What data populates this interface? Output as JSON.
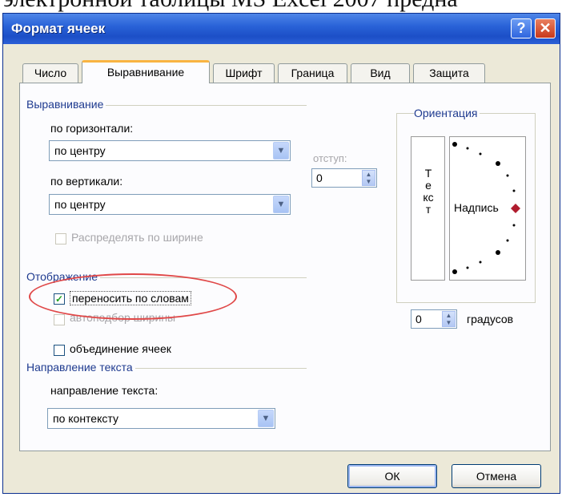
{
  "page_text": "электронной таблицы MS Excel 2007 предна",
  "window": {
    "title": "Формат ячеек",
    "help_label": "?",
    "close_label": "✕"
  },
  "tabs": [
    {
      "label": "Число"
    },
    {
      "label": "Выравнивание",
      "active": true
    },
    {
      "label": "Шрифт"
    },
    {
      "label": "Граница"
    },
    {
      "label": "Вид"
    },
    {
      "label": "Защита"
    }
  ],
  "alignment": {
    "group_title": "Выравнивание",
    "horizontal_label": "по горизонтали:",
    "horizontal_value": "по центру",
    "vertical_label": "по вертикали:",
    "vertical_value": "по центру",
    "indent_label": "отступ:",
    "indent_value": "0",
    "distribute_label": "Распределять по ширине"
  },
  "display": {
    "group_title": "Отображение",
    "wrap_text_label": "переносить по словам",
    "wrap_text_checked": true,
    "shrink_label": "автоподбор ширины",
    "merge_label": "объединение ячеек"
  },
  "direction": {
    "group_title": "Направление текста",
    "direction_label": "направление текста:",
    "direction_value": "по контексту"
  },
  "orientation": {
    "group_title": "Ориентация",
    "vertical_text": "Текст",
    "dial_label": "Надпись",
    "degrees_value": "0",
    "degrees_label": "градусов",
    "marker_color": "#b01c2e"
  },
  "buttons": {
    "ok": "ОК",
    "cancel": "Отмена"
  },
  "colors": {
    "titlebar": "#2a63d8",
    "highlight": "#e04848",
    "group_label": "#1e3a8f"
  }
}
